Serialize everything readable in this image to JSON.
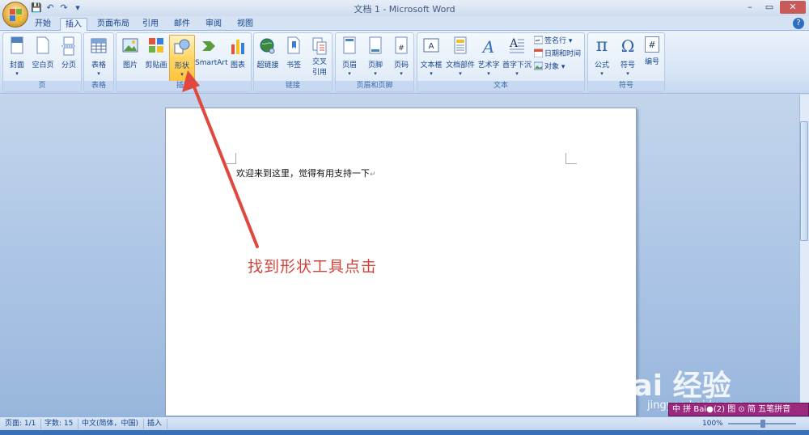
{
  "window": {
    "title": "文档 1 - Microsoft Word",
    "min_glyph": "–",
    "max_glyph": "▭",
    "close_glyph": "✕"
  },
  "qat": {
    "save_glyph": "💾",
    "undo_glyph": "↶",
    "redo_glyph": "↷",
    "more_glyph": "▾"
  },
  "tabs": [
    {
      "label": "开始"
    },
    {
      "label": "插入"
    },
    {
      "label": "页面布局"
    },
    {
      "label": "引用"
    },
    {
      "label": "邮件"
    },
    {
      "label": "审阅"
    },
    {
      "label": "视图"
    }
  ],
  "help_glyph": "?",
  "ribbon": {
    "groups": {
      "pages": "页",
      "tables": "表格",
      "illustrations": "插图",
      "links": "链接",
      "header_footer": "页眉和页脚",
      "text": "文本",
      "symbols": "符号"
    },
    "buttons": {
      "cover": "封面",
      "blank": "空白页",
      "break": "分页",
      "table": "表格",
      "picture": "图片",
      "clipart": "剪贴画",
      "shapes": "形状",
      "smartart": "SmartArt",
      "chart": "图表",
      "hyperlink": "超链接",
      "bookmark": "书签",
      "crossref1": "交叉",
      "crossref2": "引用",
      "header": "页眉",
      "footer": "页脚",
      "pagenum": "页码",
      "textbox": "文本框",
      "quickparts": "文档部件",
      "wordart": "艺术字",
      "dropcap": "首字下沉",
      "signature": "签名行",
      "datetime": "日期和时间",
      "object": "对象",
      "equation": "公式",
      "symbol": "符号",
      "number": "编号"
    },
    "glyphs": {
      "dropdown": "▾",
      "pi": "π",
      "omega": "Ω",
      "hash": "#"
    }
  },
  "document": {
    "text": "欢迎来到这里，觉得有用支持一下",
    "para_mark": "↵"
  },
  "annotation": "找到形状工具点击",
  "watermark": {
    "brand": "Bai  经验",
    "url": "jingyan.baidu.com"
  },
  "ime": "中 拼 Bai●(2) 图 ⊙ 简  五笔拼音",
  "status": {
    "page": "页面: 1/1",
    "words": "字数: 15",
    "language": "中文(简体，中国)",
    "mode": "插入",
    "zoom": "100%"
  },
  "colors": {
    "accent": "#d0443b",
    "ribbon": "#dde9f7",
    "active_button": "#ffd566"
  }
}
